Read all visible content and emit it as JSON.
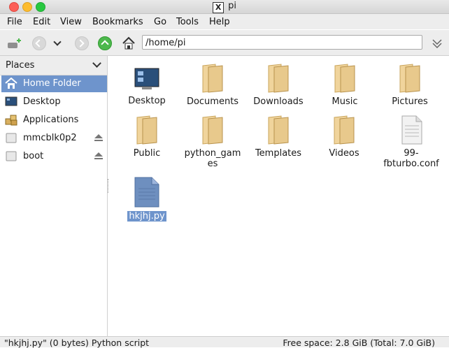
{
  "window": {
    "title": "pi"
  },
  "menu": [
    "File",
    "Edit",
    "View",
    "Bookmarks",
    "Go",
    "Tools",
    "Help"
  ],
  "location": {
    "path": "/home/pi"
  },
  "places": {
    "title": "Places",
    "items": [
      {
        "label": "Home Folder",
        "icon": "home-icon",
        "selected": true
      },
      {
        "label": "Desktop",
        "icon": "desktop-icon"
      },
      {
        "label": "Applications",
        "icon": "applications-icon"
      },
      {
        "label": "mmcblk0p2",
        "icon": "drive-icon",
        "eject": true
      },
      {
        "label": "boot",
        "icon": "drive-icon",
        "eject": true
      }
    ]
  },
  "files": [
    {
      "label": "Desktop",
      "type": "desktop"
    },
    {
      "label": "Documents",
      "type": "folder"
    },
    {
      "label": "Downloads",
      "type": "folder"
    },
    {
      "label": "Music",
      "type": "folder"
    },
    {
      "label": "Pictures",
      "type": "folder"
    },
    {
      "label": "Public",
      "type": "folder"
    },
    {
      "label": "python_gam es",
      "type": "folder"
    },
    {
      "label": "Templates",
      "type": "folder"
    },
    {
      "label": "Videos",
      "type": "folder"
    },
    {
      "label": "99- fbturbo.conf",
      "type": "file"
    },
    {
      "label": "hkjhj.py",
      "type": "script",
      "selected": true
    }
  ],
  "status": {
    "left": "\"hkjhj.py\" (0 bytes) Python script",
    "right": "Free space: 2.8 GiB (Total: 7.0 GiB)"
  },
  "colors": {
    "selection": "#6e94cc",
    "folder": "#e8c98c",
    "up": "#4db84d"
  }
}
